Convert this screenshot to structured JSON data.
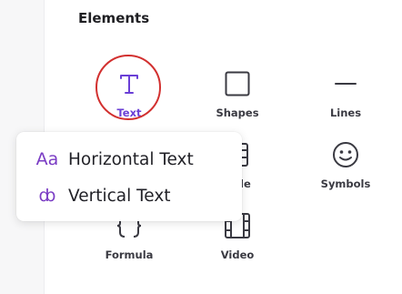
{
  "panel": {
    "title": "Elements"
  },
  "tiles": [
    {
      "label": "Text",
      "icon": "text-icon",
      "selected": true
    },
    {
      "label": "Shapes",
      "icon": "square-icon"
    },
    {
      "label": "Lines",
      "icon": "line-icon"
    },
    {
      "label": "",
      "icon": "frame-icon"
    },
    {
      "label": "le",
      "icon": "table-icon"
    },
    {
      "label": "Symbols",
      "icon": "smiley-icon"
    },
    {
      "label": "Formula",
      "icon": "braces-icon"
    },
    {
      "label": "Video",
      "icon": "film-icon"
    }
  ],
  "text_menu": {
    "items": [
      {
        "label": "Horizontal Text",
        "glyph": "Aa",
        "icon": "horizontal-text-icon"
      },
      {
        "label": "Vertical Text",
        "glyph": "ȸ",
        "icon": "vertical-text-icon"
      }
    ]
  },
  "colors": {
    "accent": "#6a3fd6",
    "highlight_ring": "#d2302f",
    "menu_icon": "#7a3cc4"
  }
}
